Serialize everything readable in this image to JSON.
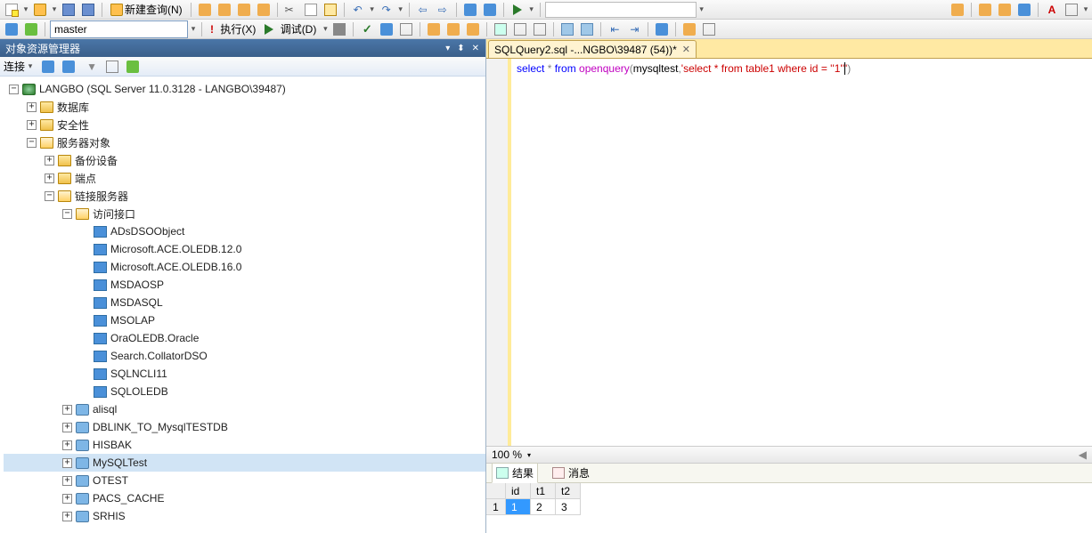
{
  "toolbar": {
    "new_query": "新建查询(N)",
    "execute": "执行(X)",
    "debug": "调试(D)",
    "db_selected": "master"
  },
  "objexp": {
    "title": "对象资源管理器",
    "connect": "连接",
    "root": "LANGBO (SQL Server 11.0.3128 - LANGBO\\39487)",
    "db": "数据库",
    "security": "安全性",
    "server_obj": "服务器对象",
    "backup_dev": "备份设备",
    "endpoints": "端点",
    "linked_servers": "链接服务器",
    "providers_folder": "访问接口",
    "providers": [
      "ADsDSOObject",
      "Microsoft.ACE.OLEDB.12.0",
      "Microsoft.ACE.OLEDB.16.0",
      "MSDAOSP",
      "MSDASQL",
      "MSOLAP",
      "OraOLEDB.Oracle",
      "Search.CollatorDSO",
      "SQLNCLI11",
      "SQLOLEDB"
    ],
    "linked": [
      "alisql",
      "DBLINK_TO_MysqlTESTDB",
      "HISBAK",
      "MySQLTest",
      "OTEST",
      "PACS_CACHE",
      "SRHIS"
    ],
    "linked_selected": "MySQLTest"
  },
  "editor": {
    "tab": "SQLQuery2.sql -...NGBO\\39487 (54))*",
    "kw_select": "select",
    "star": " * ",
    "kw_from": "from",
    "fn_openquery": " openquery",
    "paren_open": "(",
    "arg1": "mysqltest",
    "comma": ",",
    "str_open": "'",
    "str_body": "select * from table1 where id = ''1''",
    "str_close": "'",
    "paren_close": ")",
    "zoom": "100 %"
  },
  "results": {
    "tab_results": "结果",
    "tab_messages": "消息",
    "cols": [
      "id",
      "t1",
      "t2"
    ],
    "rownum": "1",
    "row": [
      "1",
      "2",
      "3"
    ]
  }
}
